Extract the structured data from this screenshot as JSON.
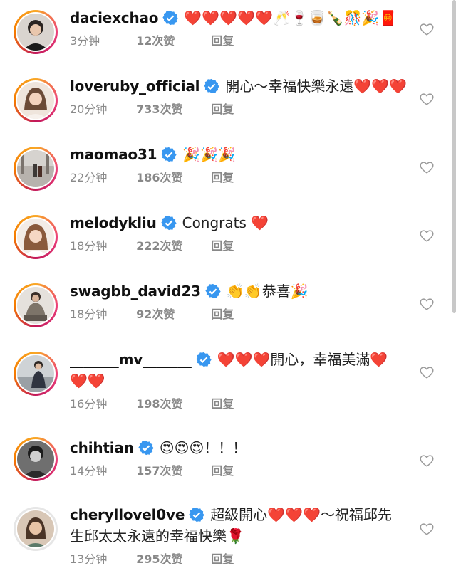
{
  "colors": {
    "heart": "#e02424",
    "verified": "#3897f0",
    "meta": "#8a8a8a"
  },
  "comments": [
    {
      "username": "daciexchao",
      "verified": true,
      "text": "❤️❤️❤️❤️❤️🥂🍷🥃🍾🎊🎉🧧",
      "time": "3分钟",
      "likes": "12次赞",
      "reply": "回复",
      "avatar_icon": "man-portrait-icon"
    },
    {
      "username": "loveruby_official",
      "verified": true,
      "text": "開心～幸福快樂永遠❤️❤️❤️",
      "time": "20分钟",
      "likes": "733次赞",
      "reply": "回复",
      "avatar_icon": "woman-portrait-icon"
    },
    {
      "username": "maomao31",
      "verified": true,
      "text": "🎉🎉🎉",
      "time": "22分钟",
      "likes": "186次赞",
      "reply": "回复",
      "avatar_icon": "street-photo-icon"
    },
    {
      "username": "melodykliu",
      "verified": true,
      "text": "Congrats ❤️",
      "time": "18分钟",
      "likes": "222次赞",
      "reply": "回复",
      "avatar_icon": "woman-portrait-icon"
    },
    {
      "username": "swagbb_david23",
      "verified": true,
      "text": "👏👏恭喜🎉",
      "time": "18分钟",
      "likes": "92次赞",
      "reply": "回复",
      "avatar_icon": "seated-man-icon"
    },
    {
      "username": "_______mv_______",
      "verified": true,
      "text": "❤️❤️❤️開心，幸福美滿❤️❤️❤️",
      "time": "16分钟",
      "likes": "198次赞",
      "reply": "回复",
      "avatar_icon": "man-standing-icon"
    },
    {
      "username": "chihtian",
      "verified": true,
      "text": "😍😍😍！！！",
      "time": "14分钟",
      "likes": "157次赞",
      "reply": "回复",
      "avatar_icon": "man-portrait-icon"
    },
    {
      "username": "cheryllovel0ve",
      "verified": true,
      "text": "超級開心❤️❤️❤️～祝福邱先生邱太太永遠的幸福快樂🌹",
      "time": "13分钟",
      "likes": "295次赞",
      "reply": "回复",
      "avatar_icon": "woman-portrait-icon"
    }
  ]
}
